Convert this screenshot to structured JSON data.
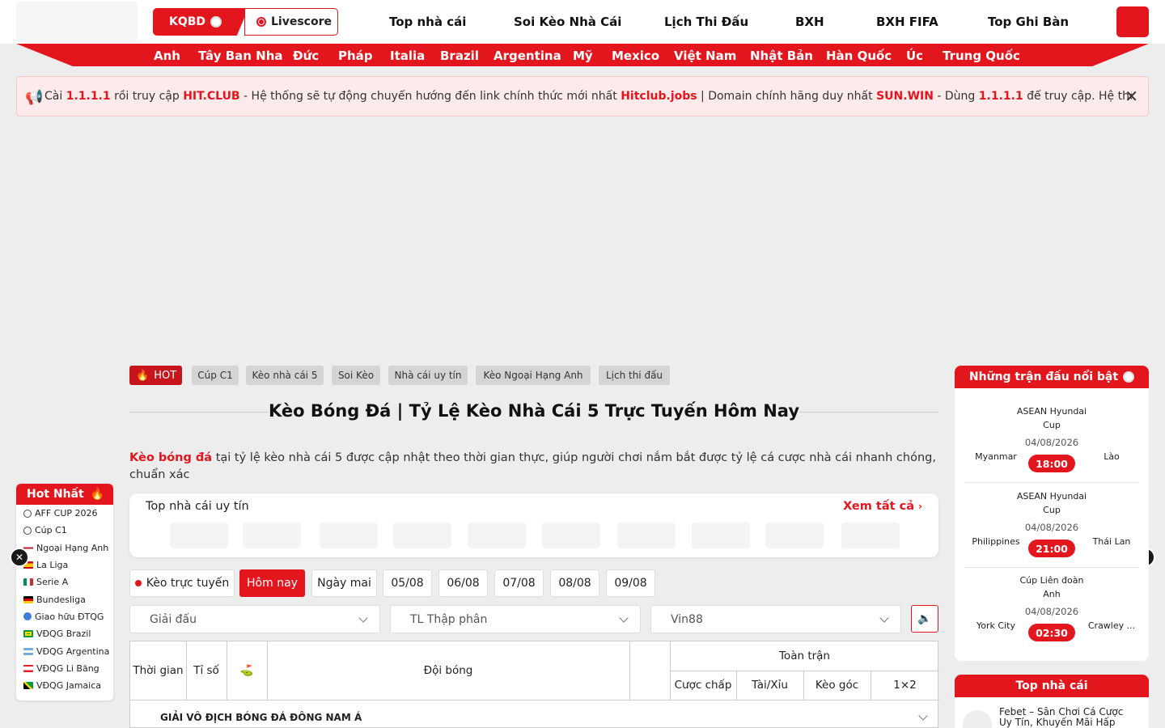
{
  "header": {
    "kqbd_label": "KQBD",
    "livescore_label": "Livescore",
    "nav": [
      "Top nhà cái",
      "Soi Kèo Nhà Cái",
      "Lịch Thi Đấu",
      "BXH",
      "BXH FIFA",
      "Top Ghi Bàn"
    ]
  },
  "subnav": [
    "Anh",
    "Tây Ban Nha",
    "Đức",
    "Pháp",
    "Italia",
    "Brazil",
    "Argentina",
    "Mỹ",
    "Mexico",
    "Việt Nam",
    "Nhật Bản",
    "Hàn Quốc",
    "Úc",
    "Trung Quốc"
  ],
  "notice": {
    "parts": [
      {
        "t": "Cài ",
        "b": false
      },
      {
        "t": "1.1.1.1",
        "b": true
      },
      {
        "t": " rồi truy cập ",
        "b": false
      },
      {
        "t": "HIT.CLUB",
        "b": true
      },
      {
        "t": " - Hệ thống sẽ tự động chuyển hướng đến link chính thức mới nhất ",
        "b": false
      },
      {
        "t": "Hitclub.jobs",
        "b": true
      },
      {
        "t": " | Domain chính hãng duy nhất ",
        "b": false
      },
      {
        "t": "SUN.WIN",
        "b": true
      },
      {
        "t": " - Dùng ",
        "b": false
      },
      {
        "t": "1.1.1.1",
        "b": true
      },
      {
        "t": " để truy cập. Hệ thống sẽ tự động chuyển h",
        "b": false
      }
    ]
  },
  "tags": {
    "hot_label": "HOT",
    "items": [
      "Cúp C1",
      "Kèo nhà cái 5",
      "Soi Kèo",
      "Nhà cái uy tín",
      "Kèo Ngoại Hạng Anh",
      "Lịch thi đấu"
    ]
  },
  "page": {
    "title": "Kèo Bóng Đá | Tỷ Lệ Kèo Nhà Cái 5 Trực Tuyến Hôm Nay",
    "intro_bold": "Kèo bóng đá",
    "intro_rest": " tại tỷ lệ kèo nhà cái 5 được cập nhật theo thời gian thực, giúp người chơi nắm bắt được tỷ lệ cá cược nhà cái nhanh chóng, chuẩn xác"
  },
  "top_box": {
    "title": "Top nhà cái uy tín",
    "see_all": "Xem tất cả"
  },
  "date_tabs": [
    "Kèo trực tuyến",
    "Hôm nay",
    "Ngày mai",
    "05/08",
    "06/08",
    "07/08",
    "08/08",
    "09/08"
  ],
  "filters": {
    "league": "Giải đấu",
    "odds_format": "TL Thập phân",
    "bookmaker": "Vin88"
  },
  "table": {
    "headers": {
      "time": "Thời gian",
      "score": "Tỉ số",
      "team": "Đội bóng",
      "full_match": "Toàn trận"
    },
    "sub_headers": [
      "Cược chấp",
      "Tài/Xỉu",
      "Kèo góc",
      "1×2"
    ],
    "league_row": "GIẢI VÔ ĐỊCH BÓNG ĐÁ ĐÔNG NAM Á"
  },
  "hot_box": {
    "title": "Hot Nhất",
    "items": [
      {
        "label": "AFF CUP 2026",
        "icon": "soccer-ball-icon"
      },
      {
        "label": "Cúp C1",
        "icon": "soccer-ball-icon"
      },
      {
        "label": "Ngoại Hạng Anh",
        "icon": "flag-england-icon"
      },
      {
        "label": "La Liga",
        "icon": "flag-spain-icon"
      },
      {
        "label": "Serie A",
        "icon": "flag-italy-icon"
      },
      {
        "label": "Bundesliga",
        "icon": "flag-germany-icon"
      },
      {
        "label": "Giao hữu ĐTQG",
        "icon": "globe-icon"
      },
      {
        "label": "VĐQG Brazil",
        "icon": "flag-brazil-icon"
      },
      {
        "label": "VĐQG Argentina",
        "icon": "flag-argentina-icon"
      },
      {
        "label": "VĐQG Li Băng",
        "icon": "flag-lebanon-icon"
      },
      {
        "label": "VĐQG Jamaica",
        "icon": "flag-jamaica-icon"
      }
    ]
  },
  "featured": {
    "title": "Những trận đấu nổi bật",
    "matches": [
      {
        "league": "ASEAN Hyundai Cup",
        "date": "04/08/2026",
        "time": "18:00",
        "home": "Myanmar",
        "away": "Lào"
      },
      {
        "league": "ASEAN Hyundai Cup",
        "date": "04/08/2026",
        "time": "21:00",
        "home": "Philippines",
        "away": "Thái Lan"
      },
      {
        "league": "Cúp Liên đoàn Anh",
        "date": "04/08/2026",
        "time": "02:30",
        "home": "York City",
        "away": "Crawley ..."
      }
    ]
  },
  "top_nc": {
    "title": "Top nhà cái",
    "item": "Febet – Sân Chơi Cá Cược Uy Tín, Khuyến Mãi Hấp"
  },
  "colors": {
    "accent": "#e3161e",
    "background": "#ededed"
  }
}
